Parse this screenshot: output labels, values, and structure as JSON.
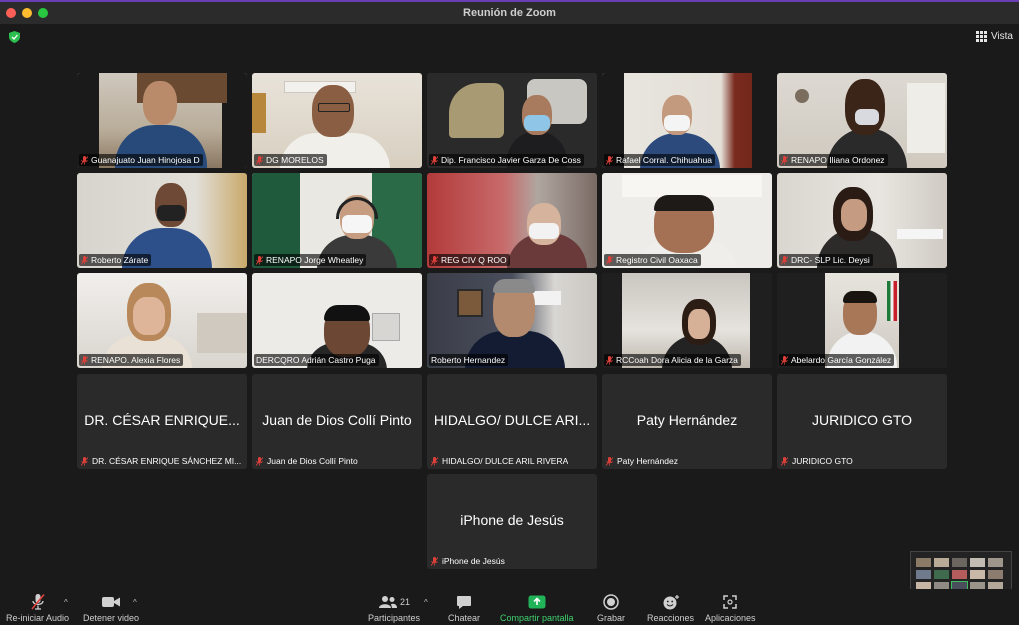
{
  "window": {
    "title": "Reunión de Zoom"
  },
  "view": {
    "label": "Vista"
  },
  "colors": {
    "accent_green": "#3fbf5f",
    "muted_red": "#e0403a",
    "window_bg": "#1a1a1a",
    "tile_bg": "#2a2a2a"
  },
  "participants_video": [
    {
      "name": "Guanajuato Juan Hinojosa D"
    },
    {
      "name": "DG MORELOS"
    },
    {
      "name": "Dip. Francisco Javier Garza De Coss"
    },
    {
      "name": "Rafael Corral. Chihuahua"
    },
    {
      "name": "RENAPO Iliana Ordonez"
    },
    {
      "name": "Roberto Zárate"
    },
    {
      "name": "RENAPO Jorge Wheatley"
    },
    {
      "name": "REG CIV Q ROO"
    },
    {
      "name": "Registro Civil Oaxaca"
    },
    {
      "name": "DRC- SLP Lic. Deysi"
    },
    {
      "name": "RENAPO. Alexia Flores"
    },
    {
      "name": "DERCQRO Adrián Castro Puga"
    },
    {
      "name": "Roberto Hernandez"
    },
    {
      "name": "RCCoah Dora Alicia de la Garza"
    },
    {
      "name": "Abelardo García González"
    }
  ],
  "participants_novideo": [
    {
      "display": "DR. CÉSAR ENRIQUE...",
      "name": "DR. CÉSAR ENRIQUE SÁNCHEZ MI..."
    },
    {
      "display": "Juan de Dios Collí Pinto",
      "name": "Juan de Dios Collí Pinto"
    },
    {
      "display": "HIDALGO/ DULCE ARI...",
      "name": "HIDALGO/ DULCE ARIL RIVERA"
    },
    {
      "display": "Paty Hernández",
      "name": "Paty Hernández"
    },
    {
      "display": "JURIDICO GTO",
      "name": "JURIDICO GTO"
    },
    {
      "display": "iPhone de Jesús",
      "name": "iPhone de Jesús"
    }
  ],
  "toolbar": {
    "audio": "Re-iniciar Audio",
    "video": "Detener video",
    "participants": "Participantes",
    "participants_count": "21",
    "chat": "Chatear",
    "share": "Compartir pantalla",
    "record": "Grabar",
    "reactions": "Reacciones",
    "apps": "Aplicaciones"
  }
}
